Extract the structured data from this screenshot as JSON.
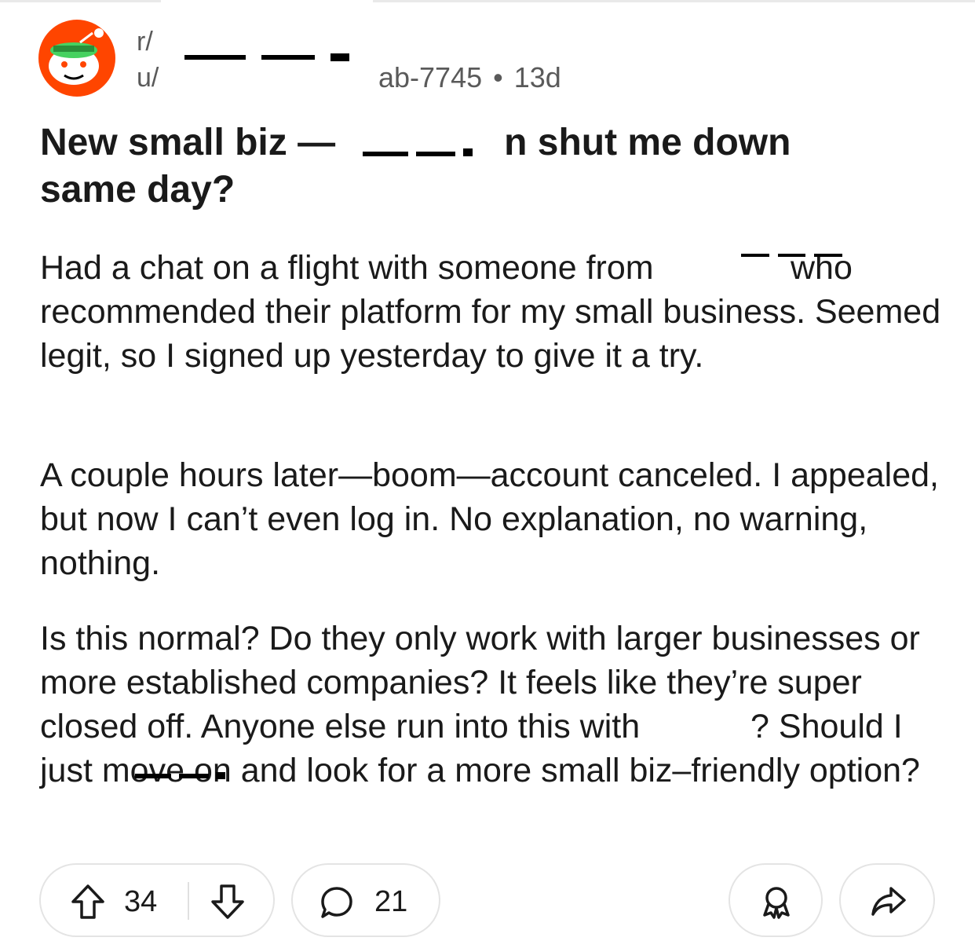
{
  "header": {
    "subreddit_prefix": "r/",
    "user_prefix": "u/",
    "handle": "ab-7745",
    "separator": "•",
    "age": "13d"
  },
  "post": {
    "title_part1": "New small biz —",
    "title_part2": "n shut me down",
    "title_line2": "same day?",
    "paragraph1": "Had a chat on a flight with someone from      who recommended their platform for my small business. Seemed legit, so I signed up yesterday to give it a try.",
    "paragraph2": "A couple hours later—boom—account canceled. I appealed, but now I can’t even log in. No explanation, no warning, nothing.",
    "paragraph3": "Is this normal? Do they only work with larger businesses or more established companies? It feels like they’re super closed off. Anyone else run into this with    ? Should I just move on and look for a more small biz–friendly option?"
  },
  "actions": {
    "upvotes": "34",
    "comments": "21"
  },
  "colors": {
    "avatar_bg": "#ff4500",
    "visor": "#46d160",
    "meta_text": "#5a5a5a",
    "pill_border": "#e4e4e4"
  },
  "icons": [
    "reddit-avatar-icon",
    "upvote-icon",
    "downvote-icon",
    "comment-icon",
    "award-icon",
    "share-icon"
  ]
}
